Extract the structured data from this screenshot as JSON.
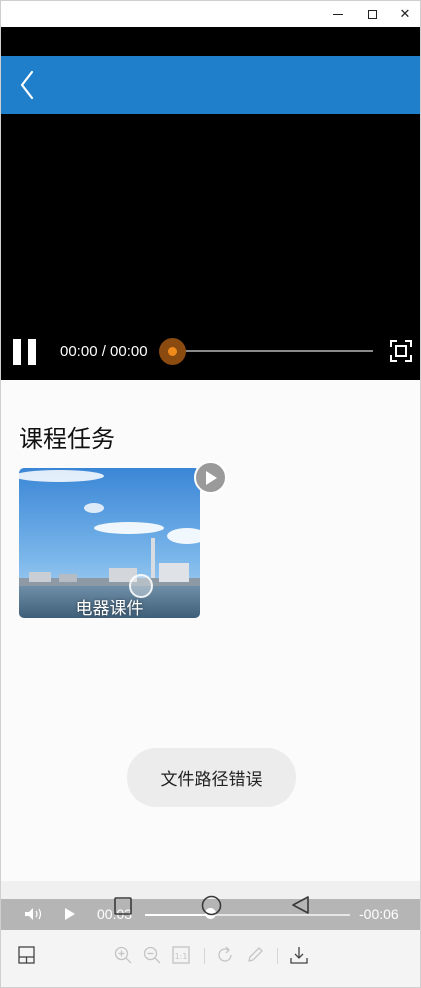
{
  "window": {
    "minimize_glyph": "",
    "maximize_glyph": "",
    "close_glyph": "✕"
  },
  "header": {
    "accent_color": "#1f7fca",
    "back_icon": "chevron-left-icon"
  },
  "video_player": {
    "time_display": "00:00 / 00:00",
    "pause_icon": "pause-icon",
    "fullscreen_icon": "fullscreen-icon",
    "progress": 0.0,
    "knob_color": "#f08a1a"
  },
  "course": {
    "section_title": "课程任务",
    "items": [
      {
        "label": "电器课件",
        "thumbnail": "factory-by-water-scene",
        "badge_icon": "play-icon"
      }
    ]
  },
  "toast": {
    "message": "文件路径错误"
  },
  "media_bar": {
    "current_time": "00:03",
    "remaining_time": "-00:06",
    "progress": 0.33,
    "volume_icon": "volume-icon",
    "play_icon": "play-icon"
  },
  "system_nav": {
    "recents_icon": "square-icon",
    "home_icon": "circle-icon",
    "back_icon": "triangle-back-icon"
  },
  "toolbar": {
    "panel_icon": "panel-layout-icon",
    "zoom_in_icon": "zoom-in-icon",
    "zoom_out_icon": "zoom-out-icon",
    "actual_size_icon": "actual-size-icon",
    "actual_size_label": "1:1",
    "rotate_icon": "rotate-icon",
    "edit_icon": "pencil-icon",
    "download_icon": "download-icon"
  }
}
